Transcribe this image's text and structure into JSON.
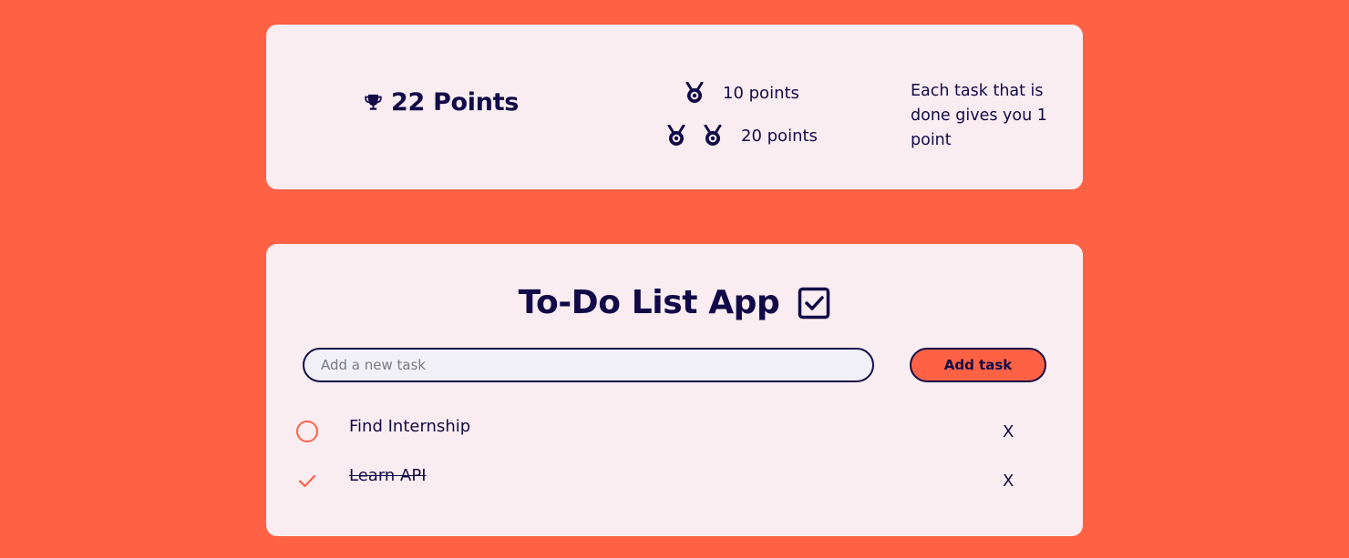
{
  "colors": {
    "background": "#ff6145",
    "card": "#f9edf1",
    "text": "#120a48",
    "accent": "#ff6145",
    "input_fill": "#f0f0f6"
  },
  "points_panel": {
    "score_icon": "trophy-icon",
    "score_label": "22 Points",
    "rewards": [
      {
        "medal_icon": "medal-icon",
        "medal_count": 1,
        "label": "10 points"
      },
      {
        "medal_icon": "medal-icon",
        "medal_count": 2,
        "label": "20 points"
      }
    ],
    "rule_text": "Each task that is done gives you 1 point"
  },
  "todo": {
    "title": "To-Do List App",
    "title_icon": "checkbox-checked-icon",
    "input": {
      "placeholder": "Add a new task",
      "value": ""
    },
    "add_button_label": "Add task",
    "tasks": [
      {
        "label": "Find Internship",
        "done": false,
        "status_icon": "circle-outline-icon",
        "delete_label": "X"
      },
      {
        "label": "Learn API",
        "done": true,
        "status_icon": "checkmark-icon",
        "delete_label": "X"
      }
    ]
  }
}
